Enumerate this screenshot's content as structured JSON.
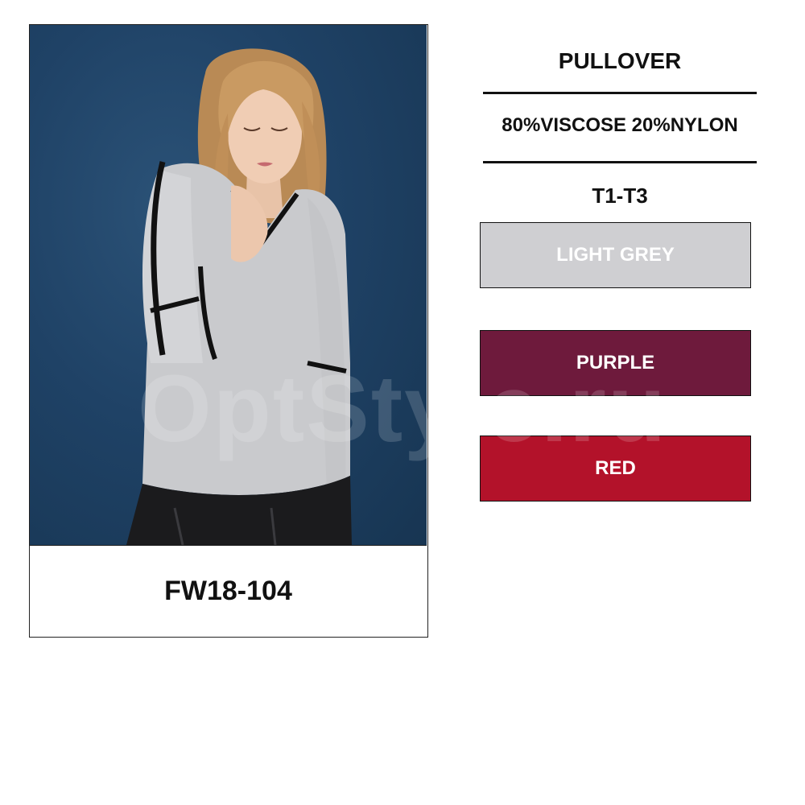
{
  "product": {
    "name": "PULLOVER",
    "composition": "80%VISCOSE 20%NYLON",
    "sizes": "T1-T3",
    "model_code": "FW18-104",
    "watermark": "OptStyle.ru"
  },
  "colors": [
    {
      "label": "LIGHT GREY",
      "hex": "#cfcfd2"
    },
    {
      "label": "PURPLE",
      "hex": "#6e1a3c"
    },
    {
      "label": "RED",
      "hex": "#b3122a"
    }
  ]
}
